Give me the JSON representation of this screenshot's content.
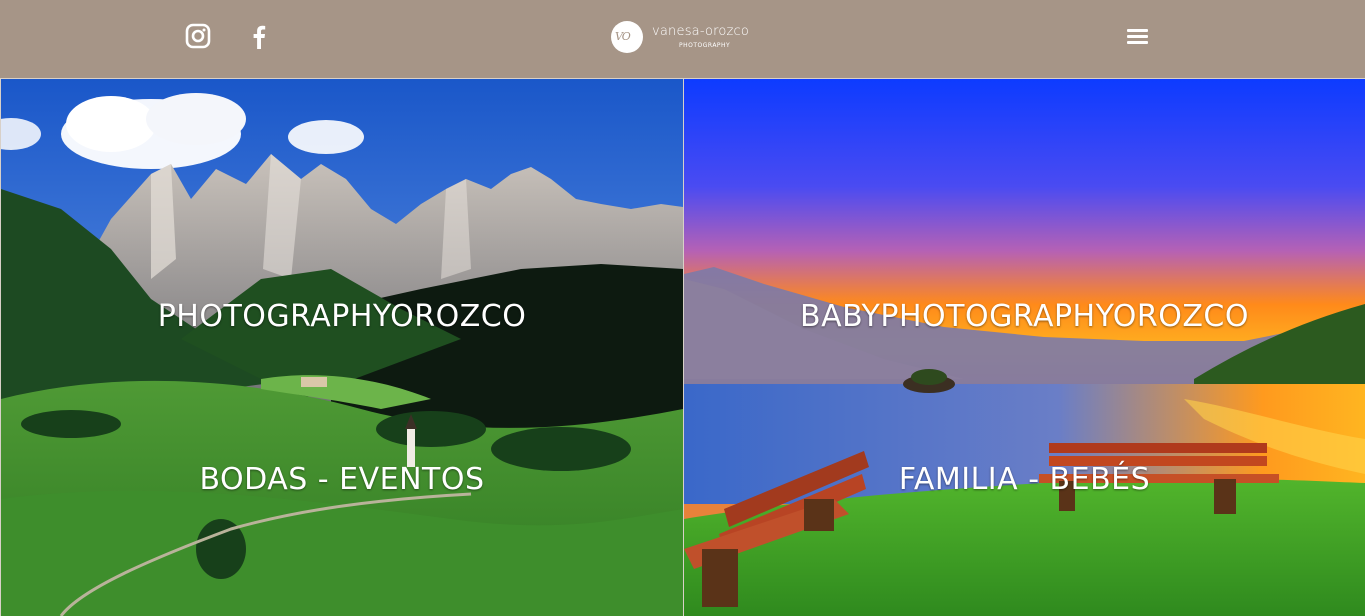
{
  "header": {
    "social": [
      {
        "icon": "instagram-icon"
      },
      {
        "icon": "facebook-icon"
      }
    ],
    "logo": {
      "name": "vanesa-orozco",
      "sub": "PHOTOGRAPHY"
    },
    "menu_icon": "hamburger-menu-icon",
    "colors": {
      "bar": "#a69587",
      "text": "#ffffff"
    }
  },
  "panels": [
    {
      "title": "PHOTOGRAPHYOROZCO",
      "cta": "BODAS - EVENTOS"
    },
    {
      "title": "BABYPHOTOGRAPHYOROZCO",
      "cta": "FAMILIA - BEBÉS"
    }
  ]
}
